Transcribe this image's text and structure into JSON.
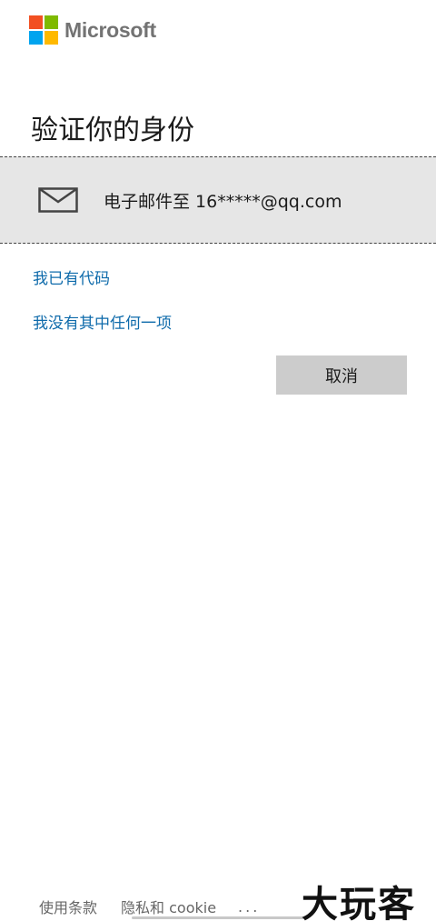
{
  "header": {
    "brand": "Microsoft",
    "logo_colors": [
      "#f25022",
      "#7fba00",
      "#00a4ef",
      "#ffb900"
    ]
  },
  "main": {
    "title": "验证你的身份",
    "option": {
      "icon": "mail-icon",
      "label": "电子邮件至 16*****@qq.com"
    },
    "links": {
      "have_code": "我已有代码",
      "none_of_these": "我没有其中任何一项"
    },
    "cancel_label": "取消"
  },
  "footer": {
    "terms": "使用条款",
    "privacy": "隐私和 cookie",
    "more": "..."
  },
  "watermark": "大玩客",
  "colors": {
    "link": "#0f6bab",
    "option_bg": "#e6e6e6",
    "button_bg": "#cccccc"
  }
}
